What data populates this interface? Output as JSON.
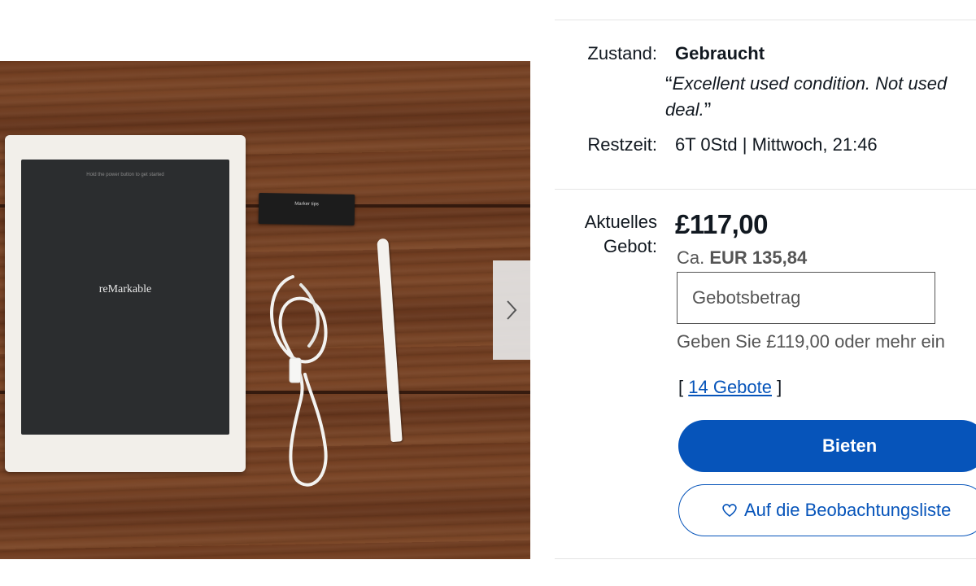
{
  "listing": {
    "condition_label": "Zustand:",
    "condition_value": "Gebraucht",
    "condition_quote_line1": "Excellent used condition. Not used",
    "condition_quote_line2": "deal.",
    "time_label": "Restzeit:",
    "time_value": "6T 0Std | Mittwoch, 21:46",
    "bid_label_line1": "Aktuelles",
    "bid_label_line2": "Gebot:",
    "current_bid": "£117,00",
    "approx_prefix": "Ca.",
    "approx_value": "EUR 135,84",
    "bid_input_placeholder": "Gebotsbetrag",
    "bid_hint": "Geben Sie £119,00 oder mehr ein",
    "bids_open": "[",
    "bids_count": "14 Gebote",
    "bids_close": "]",
    "bid_button": "Bieten",
    "watch_button": "Auf die Beobachtungsliste"
  },
  "photo": {
    "tablet_brand": "reMarkable",
    "tablet_hint": "Hold the power button to get started",
    "marker_label": "Marker tips"
  },
  "icons": {
    "next": "chevron-right-icon",
    "watch": "heart-icon"
  },
  "colors": {
    "accent": "#0654ba",
    "text": "#111820",
    "muted": "#555555"
  }
}
